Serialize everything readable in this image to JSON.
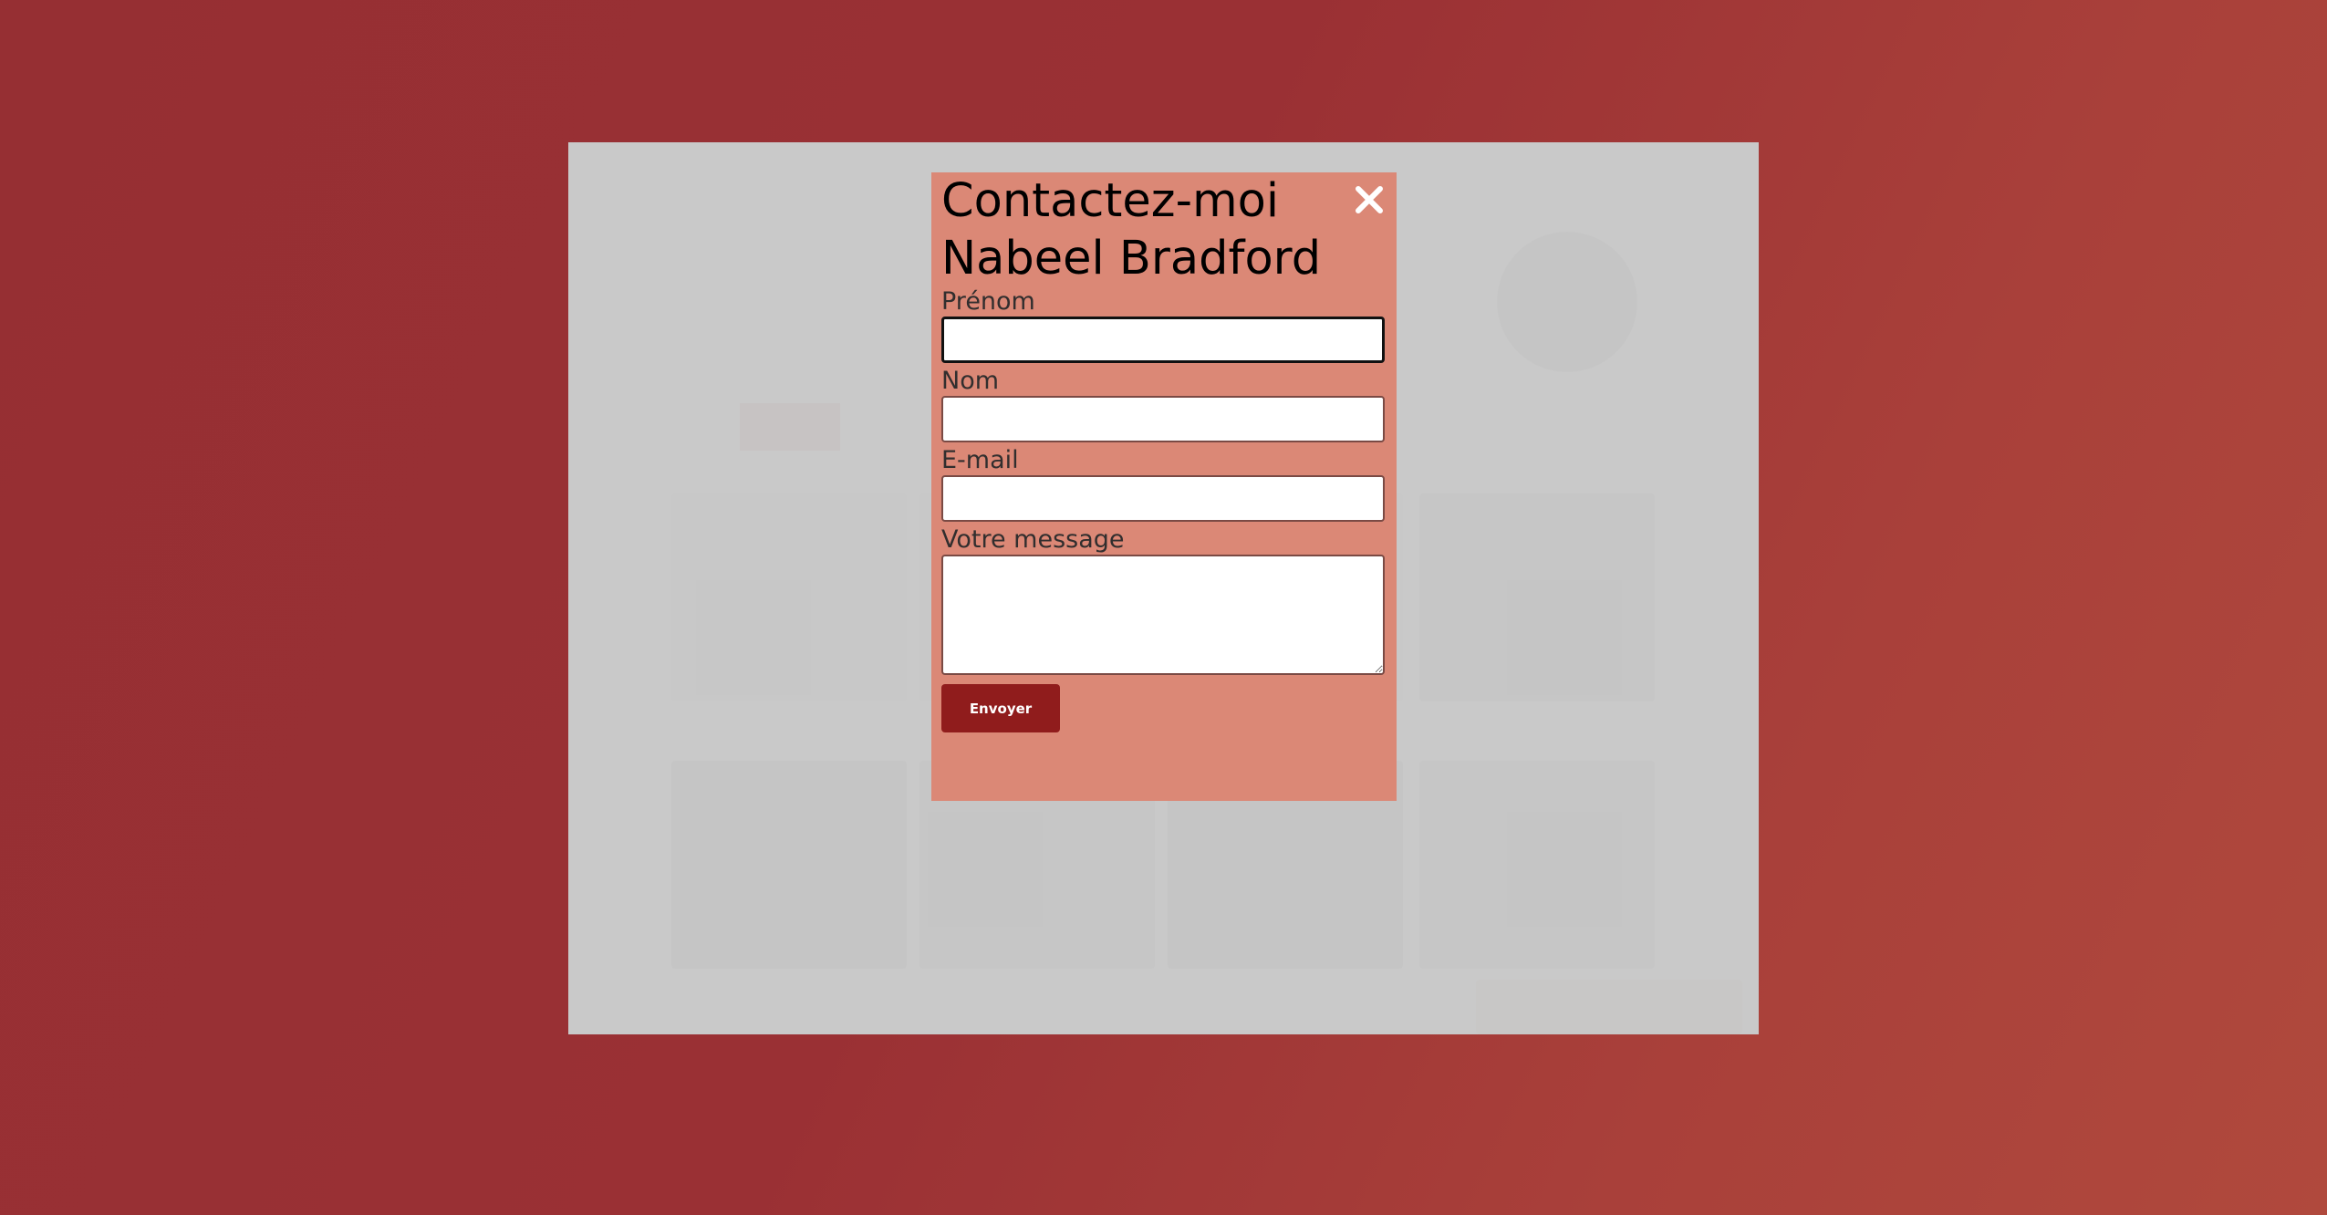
{
  "modal": {
    "title_line1": "Contactez-moi",
    "title_line2": "Nabeel Bradford",
    "close_icon": "close-icon",
    "fields": {
      "first_name_label": "Prénom",
      "first_name_value": "",
      "last_name_label": "Nom",
      "last_name_value": "",
      "email_label": "E-mail",
      "email_value": "",
      "message_label": "Votre message",
      "message_value": ""
    },
    "submit_label": "Envoyer"
  },
  "colors": {
    "background": "#9a3034",
    "modal_bg": "#db8876",
    "submit_bg": "#901c1c",
    "overlay": "#c4c4c4"
  }
}
